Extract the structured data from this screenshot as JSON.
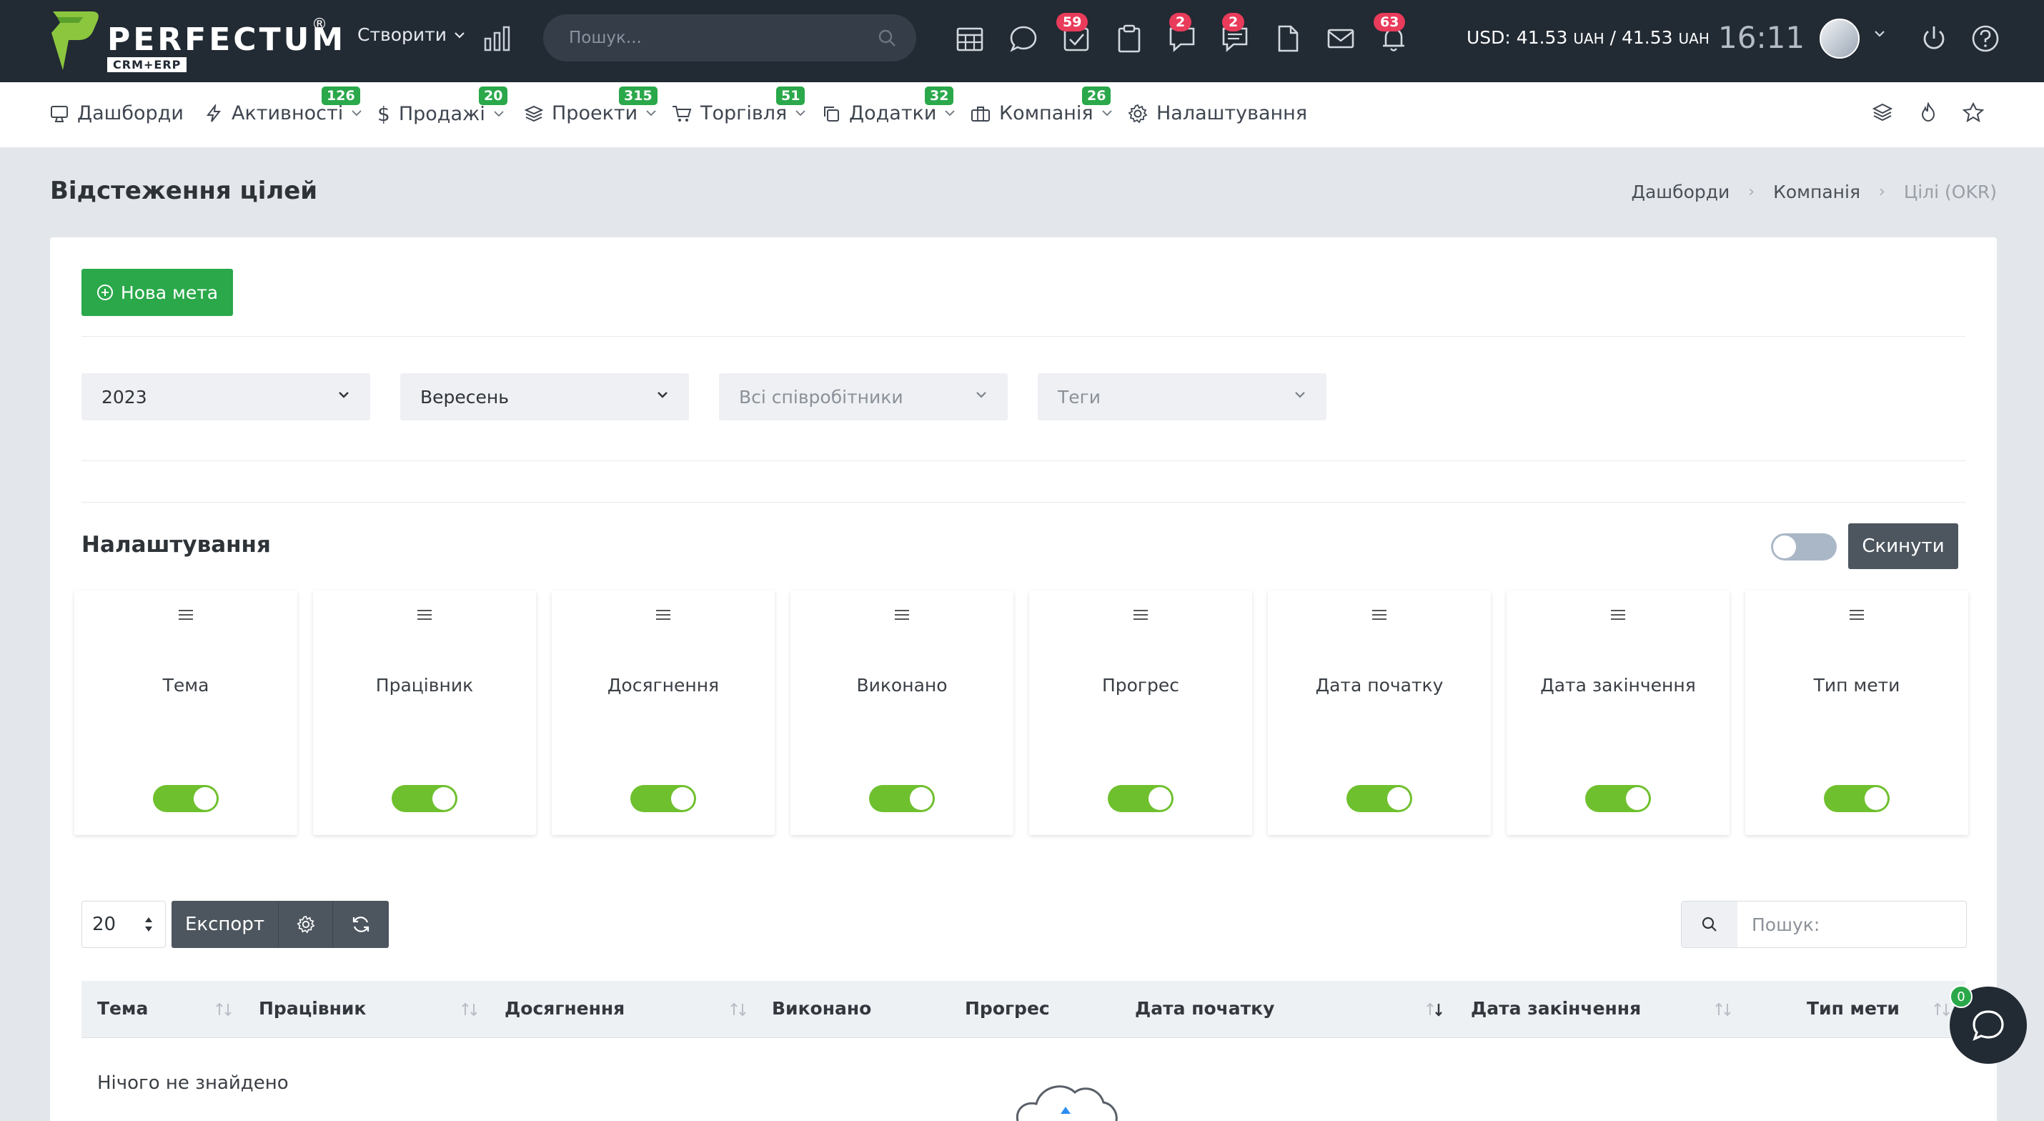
{
  "header": {
    "logo_text": "PERFECTUM",
    "logo_reg": "®",
    "logo_sub": "CRM+ERP",
    "create_label": "Створити",
    "search_placeholder": "Пошук...",
    "badges": {
      "tasks": "59",
      "chat_1": "2",
      "chat_2": "2",
      "notifications": "63"
    },
    "currency_prefix": "USD: 41.53",
    "currency_unit_1": "UAH",
    "currency_sep": " / 41.53",
    "currency_unit_2": "UAH",
    "clock": "16:11"
  },
  "nav": {
    "items": [
      {
        "label": "Дашборди",
        "badge": ""
      },
      {
        "label": "Активності",
        "badge": "126"
      },
      {
        "label": "Продажі",
        "badge": "20"
      },
      {
        "label": "Проекти",
        "badge": "315"
      },
      {
        "label": "Торгівля",
        "badge": "51"
      },
      {
        "label": "Додатки",
        "badge": "32"
      },
      {
        "label": "Компанія",
        "badge": "26"
      },
      {
        "label": "Налаштування",
        "badge": ""
      }
    ]
  },
  "page": {
    "title": "Відстеження цілей",
    "breadcrumb": [
      "Дашборди",
      "Компанія",
      "Цілі (OKR)"
    ]
  },
  "toolbar": {
    "new_goal_label": "Нова мета"
  },
  "filters": {
    "year": "2023",
    "month": "Вересень",
    "employees_placeholder": "Всі співробітники",
    "tags_placeholder": "Теги"
  },
  "settings": {
    "title": "Налаштування",
    "reset_label": "Скинути",
    "columns": [
      {
        "label": "Тема",
        "enabled": true
      },
      {
        "label": "Працівник",
        "enabled": true
      },
      {
        "label": "Досягнення",
        "enabled": true
      },
      {
        "label": "Виконано",
        "enabled": true
      },
      {
        "label": "Прогрес",
        "enabled": true
      },
      {
        "label": "Дата початку",
        "enabled": true
      },
      {
        "label": "Дата закінчення",
        "enabled": true
      },
      {
        "label": "Тип мети",
        "enabled": true
      }
    ]
  },
  "table": {
    "per_page": "20",
    "export_label": "Експорт",
    "search_placeholder": "Пошук:",
    "headers": [
      "Тема",
      "Працівник",
      "Досягнення",
      "Виконано",
      "Прогрес",
      "Дата початку",
      "Дата закінчення",
      "Тип мети"
    ],
    "empty_text": "Нічого не знайдено"
  },
  "chat": {
    "badge": "0"
  },
  "colors": {
    "topbar": "#222a33",
    "accent_green": "#2aa84a",
    "badge_red": "#e93b5a",
    "toggle_on": "#6fc02e"
  }
}
